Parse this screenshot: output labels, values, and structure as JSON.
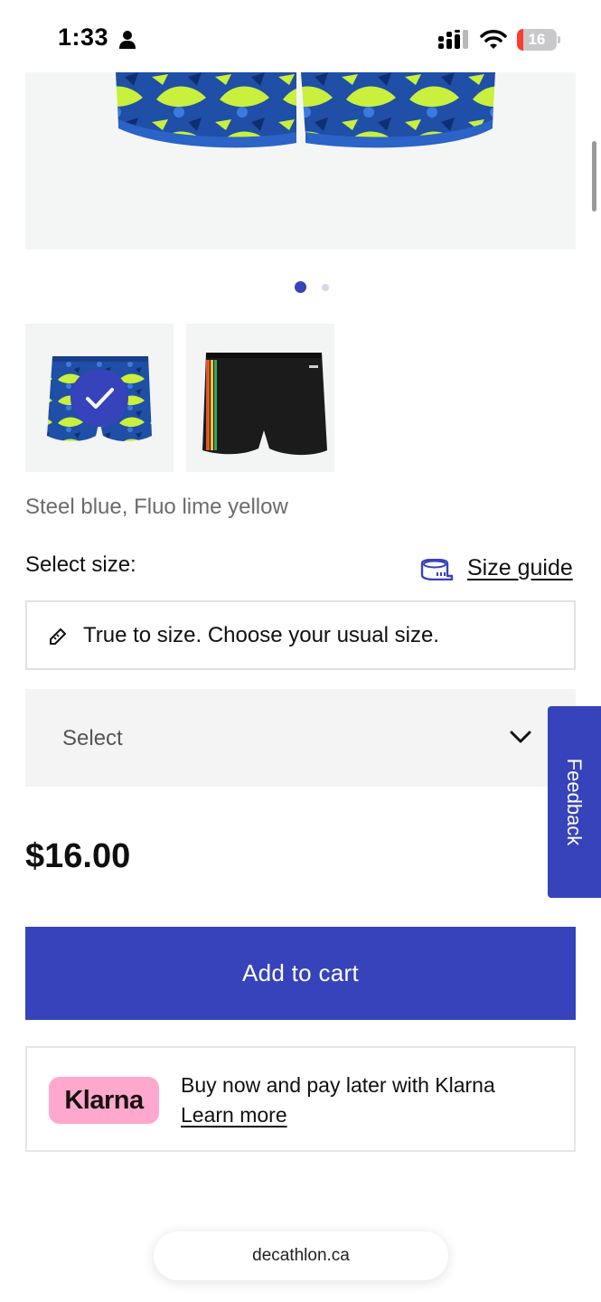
{
  "status_bar": {
    "time": "1:33",
    "battery_level": "16",
    "icons": [
      "person-icon",
      "signal-icon",
      "wifi-icon",
      "battery-icon"
    ]
  },
  "product": {
    "image_icon": "swim-shorts-shark-print",
    "carousel": {
      "total": 2,
      "active": 1
    },
    "variants": [
      {
        "icon": "swim-shorts-shark-print",
        "selected": true
      },
      {
        "icon": "swim-shorts-black",
        "selected": false
      }
    ],
    "color_name": "Steel blue, Fluo lime yellow",
    "price": "$16.00"
  },
  "size": {
    "label": "Select size:",
    "guide_label": "Size guide",
    "fit_note": "True to size. Choose your usual size.",
    "select_value": "Select"
  },
  "cart": {
    "add_label": "Add to cart"
  },
  "klarna": {
    "badge": "Klarna",
    "text": "Buy now and pay later with Klarna",
    "link": "Learn more"
  },
  "feedback": {
    "label": "Feedback"
  },
  "browser": {
    "url": "decathlon.ca"
  },
  "colors": {
    "accent": "#3643BA",
    "klarna_pink": "#FFA8CD",
    "battery_low": "#FF3B30"
  }
}
